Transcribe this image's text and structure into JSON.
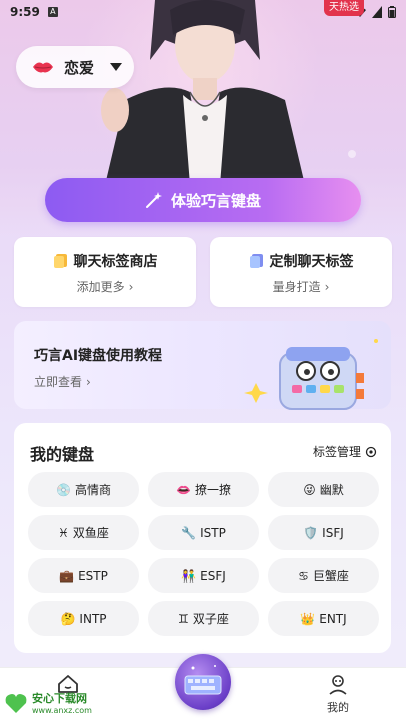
{
  "status_bar": {
    "time": "9:59",
    "hot_badge": "天热选"
  },
  "mode_selector": {
    "label": "恋爱"
  },
  "cta": {
    "label": "体验巧言键盘"
  },
  "cards": {
    "shop": {
      "title": "聊天标签商店",
      "sub": "添加更多"
    },
    "custom": {
      "title": "定制聊天标签",
      "sub": "量身打造"
    }
  },
  "tutorial": {
    "title": "巧言AI键盘使用教程",
    "sub": "立即查看"
  },
  "keyboards": {
    "title": "我的键盘",
    "manage": "标签管理",
    "items": [
      {
        "emoji": "💿",
        "label": "高情商"
      },
      {
        "emoji": "👄",
        "label": "撩一撩"
      },
      {
        "emoji": "😜",
        "label": "幽默"
      },
      {
        "emoji": "♓",
        "label": "双鱼座"
      },
      {
        "emoji": "🔧",
        "label": "ISTP"
      },
      {
        "emoji": "🛡️",
        "label": "ISFJ"
      },
      {
        "emoji": "💼",
        "label": "ESTP"
      },
      {
        "emoji": "👫",
        "label": "ESFJ"
      },
      {
        "emoji": "♋",
        "label": "巨蟹座"
      },
      {
        "emoji": "🤔",
        "label": "INTP"
      },
      {
        "emoji": "♊",
        "label": "双子座"
      },
      {
        "emoji": "👑",
        "label": "ENTJ"
      }
    ]
  },
  "bottom_nav": {
    "mine": "我的"
  },
  "watermark": {
    "brand": "安心下载网",
    "url": "www.anxz.com"
  },
  "colors": {
    "accent": "#8d5bf2",
    "accent_end": "#e78ff0"
  }
}
